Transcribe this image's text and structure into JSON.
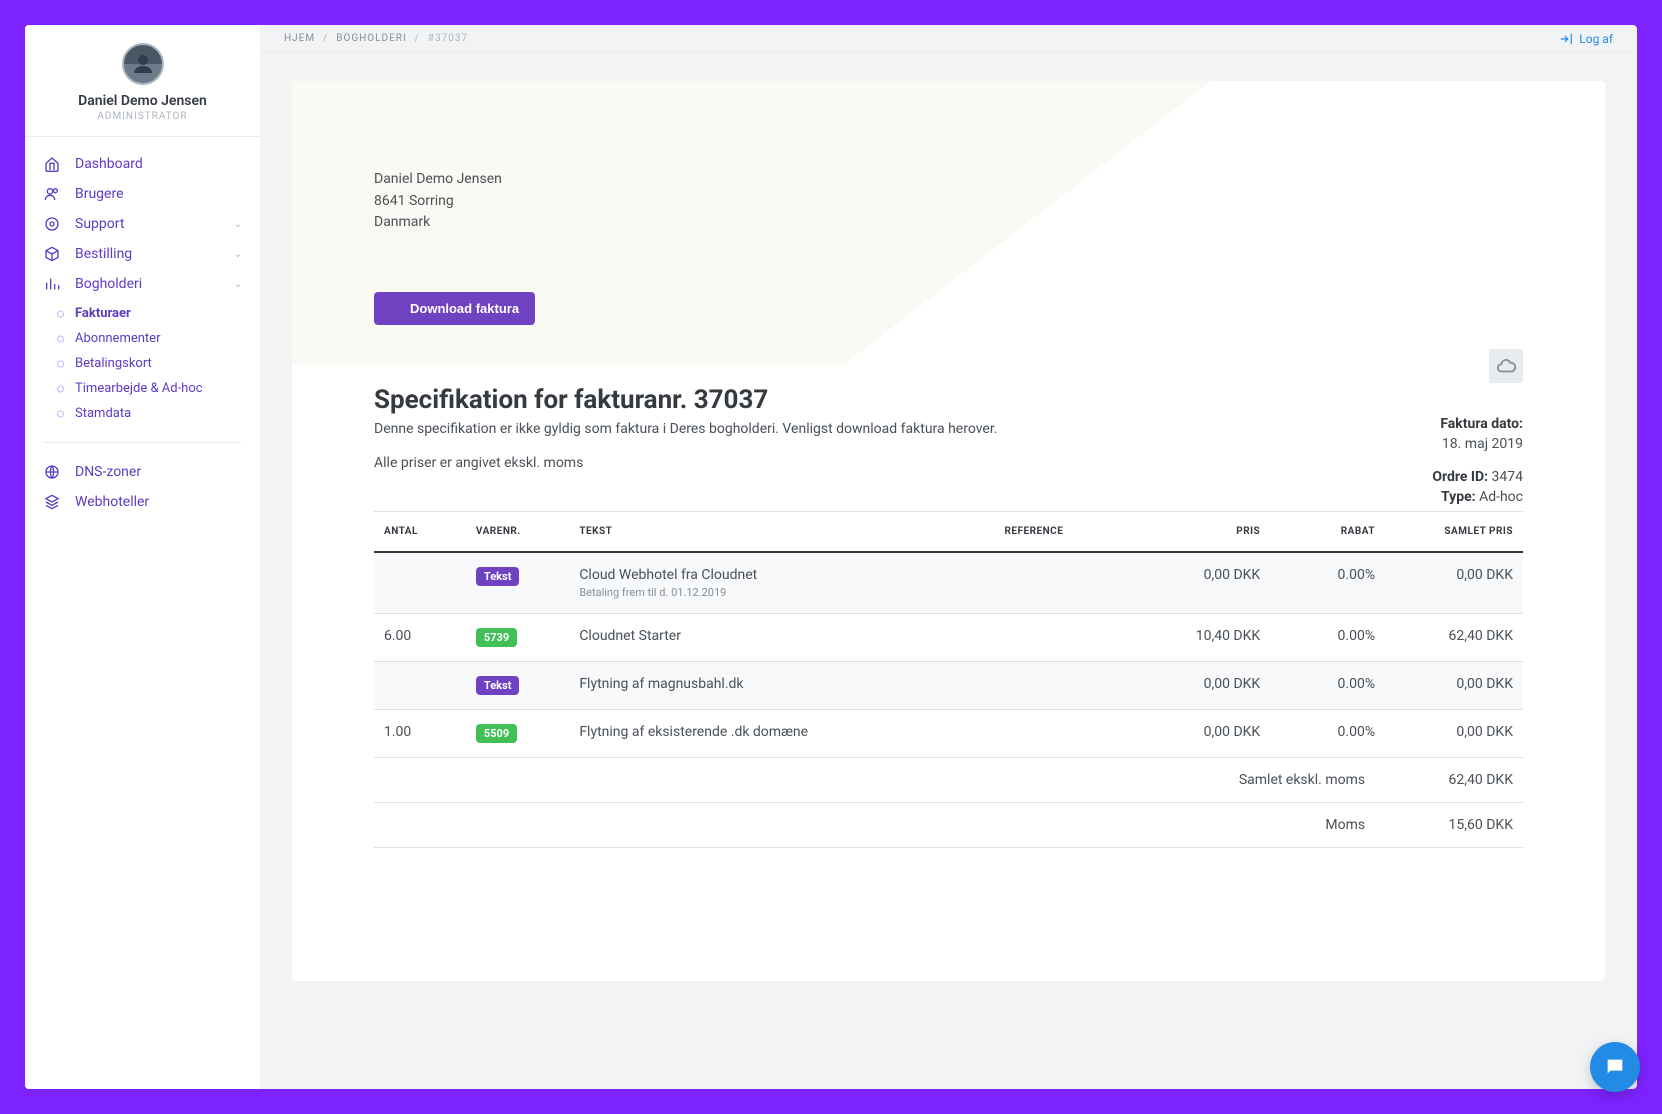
{
  "user": {
    "name": "Daniel Demo Jensen",
    "role": "ADMINISTRATOR"
  },
  "nav": {
    "dashboard": "Dashboard",
    "brugere": "Brugere",
    "support": "Support",
    "bestilling": "Bestilling",
    "bogholderi": "Bogholderi",
    "sub": {
      "fakturaer": "Fakturaer",
      "abonnementer": "Abonnementer",
      "betalingskort": "Betalingskort",
      "timearbejde": "Timearbejde & Ad-hoc",
      "stamdata": "Stamdata"
    },
    "dns": "DNS-zoner",
    "webhoteller": "Webhoteller"
  },
  "breadcrumb": {
    "hjem": "HJEM",
    "bogholderi": "BOGHOLDERI",
    "current": "#37037"
  },
  "logout": "Log af",
  "invoice": {
    "addr_name": "Daniel Demo Jensen",
    "addr_city": "8641 Sorring",
    "addr_country": "Danmark",
    "download": "Download faktura",
    "date_label": "Faktura dato:",
    "date_value": "18. maj 2019",
    "order_label": "Ordre ID:",
    "order_value": "3474",
    "type_label": "Type:",
    "type_value": "Ad-hoc"
  },
  "spec": {
    "title": "Specifikation for fakturanr. 37037",
    "subtitle": "Denne specifikation er ikke gyldig som faktura i Deres bogholderi. Venligst download faktura herover.",
    "note": "Alle priser er angivet ekskl. moms"
  },
  "table": {
    "headers": {
      "antal": "ANTAL",
      "varenr": "VARENR.",
      "tekst": "TEKST",
      "reference": "REFERENCE",
      "pris": "PRIS",
      "rabat": "RABAT",
      "samlet": "SAMLET PRIS"
    },
    "rows": [
      {
        "antal": "",
        "badge": "Tekst",
        "badge_color": "purple",
        "tekst": "Cloud Webhotel fra Cloudnet",
        "sub": "Betaling frem til d. 01.12.2019",
        "ref": "",
        "pris": "0,00 DKK",
        "rabat": "0.00%",
        "samlet": "0,00 DKK"
      },
      {
        "antal": "6.00",
        "badge": "5739",
        "badge_color": "green",
        "tekst": "Cloudnet Starter",
        "sub": "",
        "ref": "",
        "pris": "10,40 DKK",
        "rabat": "0.00%",
        "samlet": "62,40 DKK"
      },
      {
        "antal": "",
        "badge": "Tekst",
        "badge_color": "purple",
        "tekst": "Flytning af magnusbahl.dk",
        "sub": "",
        "ref": "",
        "pris": "0,00 DKK",
        "rabat": "0.00%",
        "samlet": "0,00 DKK"
      },
      {
        "antal": "1.00",
        "badge": "5509",
        "badge_color": "green",
        "tekst": "Flytning af eksisterende .dk domæne",
        "sub": "",
        "ref": "",
        "pris": "0,00 DKK",
        "rabat": "0.00%",
        "samlet": "0,00 DKK"
      }
    ],
    "totals": [
      {
        "label": "Samlet ekskl. moms",
        "value": "62,40 DKK"
      },
      {
        "label": "Moms",
        "value": "15,60 DKK"
      }
    ]
  }
}
